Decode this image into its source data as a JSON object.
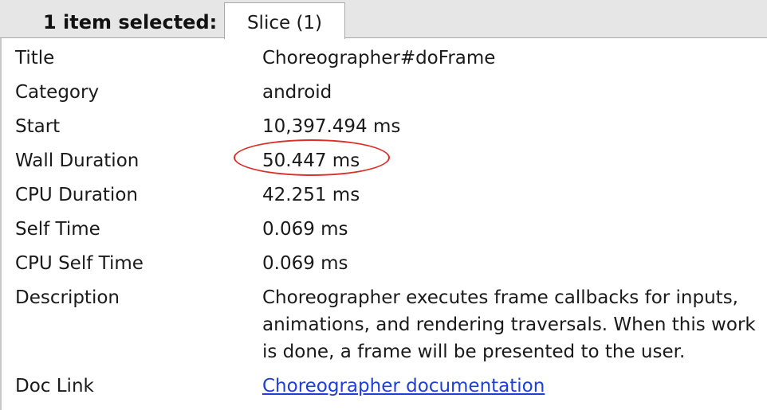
{
  "header": {
    "selection_text": "1 item selected:",
    "tab_label": "Slice (1)"
  },
  "details": [
    {
      "label": "Title",
      "value": "Choreographer#doFrame"
    },
    {
      "label": "Category",
      "value": "android"
    },
    {
      "label": "Start",
      "value": "10,397.494 ms"
    },
    {
      "label": "Wall Duration",
      "value": "50.447 ms"
    },
    {
      "label": "CPU Duration",
      "value": "42.251 ms"
    },
    {
      "label": "Self Time",
      "value": "0.069 ms"
    },
    {
      "label": "CPU Self Time",
      "value": "0.069 ms"
    },
    {
      "label": "Description",
      "value": "Choreographer executes frame callbacks for inputs, animations, and rendering traversals. When this work is done, a frame will be presented to the user."
    },
    {
      "label": "Doc Link",
      "value": "Choreographer documentation"
    }
  ],
  "colors": {
    "link": "#1f3fd6",
    "annotation": "#d9302a",
    "tabbar": "#e6e6e6"
  }
}
